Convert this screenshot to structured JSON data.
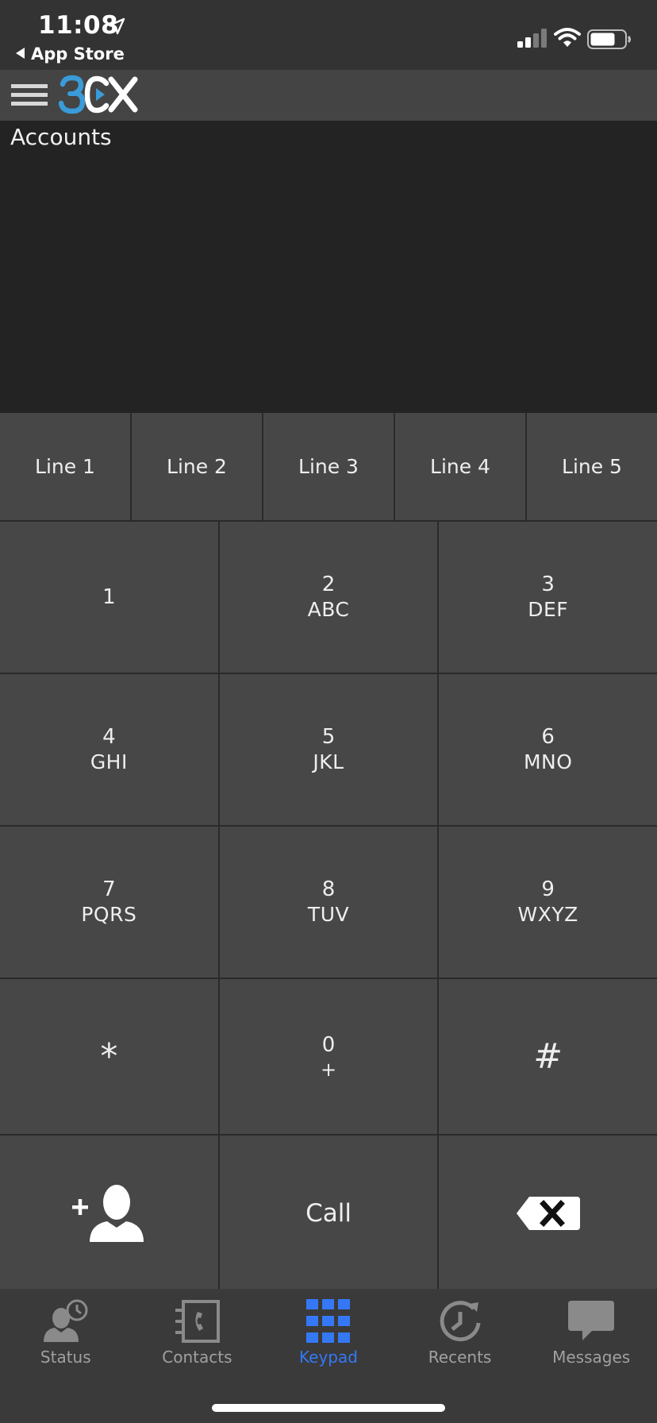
{
  "status_bar": {
    "time": "11:08",
    "back_app": "App Store"
  },
  "header": {
    "logo_text": "3CX",
    "logo_accent_color": "#3a9bd9"
  },
  "accounts": {
    "title": "Accounts"
  },
  "lines": [
    {
      "label": "Line 1"
    },
    {
      "label": "Line 2"
    },
    {
      "label": "Line 3"
    },
    {
      "label": "Line 4"
    },
    {
      "label": "Line 5"
    }
  ],
  "keypad": {
    "keys": [
      {
        "digit": "1",
        "letters": ""
      },
      {
        "digit": "2",
        "letters": "ABC"
      },
      {
        "digit": "3",
        "letters": "DEF"
      },
      {
        "digit": "4",
        "letters": "GHI"
      },
      {
        "digit": "5",
        "letters": "JKL"
      },
      {
        "digit": "6",
        "letters": "MNO"
      },
      {
        "digit": "7",
        "letters": "PQRS"
      },
      {
        "digit": "8",
        "letters": "TUV"
      },
      {
        "digit": "9",
        "letters": "WXYZ"
      },
      {
        "digit": "*",
        "letters": ""
      },
      {
        "digit": "0",
        "letters": "+"
      },
      {
        "digit": "#",
        "letters": ""
      }
    ],
    "add_contact_icon": "add-contact-icon",
    "call_label": "Call",
    "backspace_icon": "backspace-icon"
  },
  "tab_bar": {
    "items": [
      {
        "label": "Status",
        "icon": "status-icon",
        "active": false
      },
      {
        "label": "Contacts",
        "icon": "contacts-icon",
        "active": false
      },
      {
        "label": "Keypad",
        "icon": "keypad-icon",
        "active": true
      },
      {
        "label": "Recents",
        "icon": "recents-icon",
        "active": false
      },
      {
        "label": "Messages",
        "icon": "messages-icon",
        "active": false
      }
    ],
    "active_color": "#3478f6",
    "inactive_color": "#a0a0a0"
  }
}
